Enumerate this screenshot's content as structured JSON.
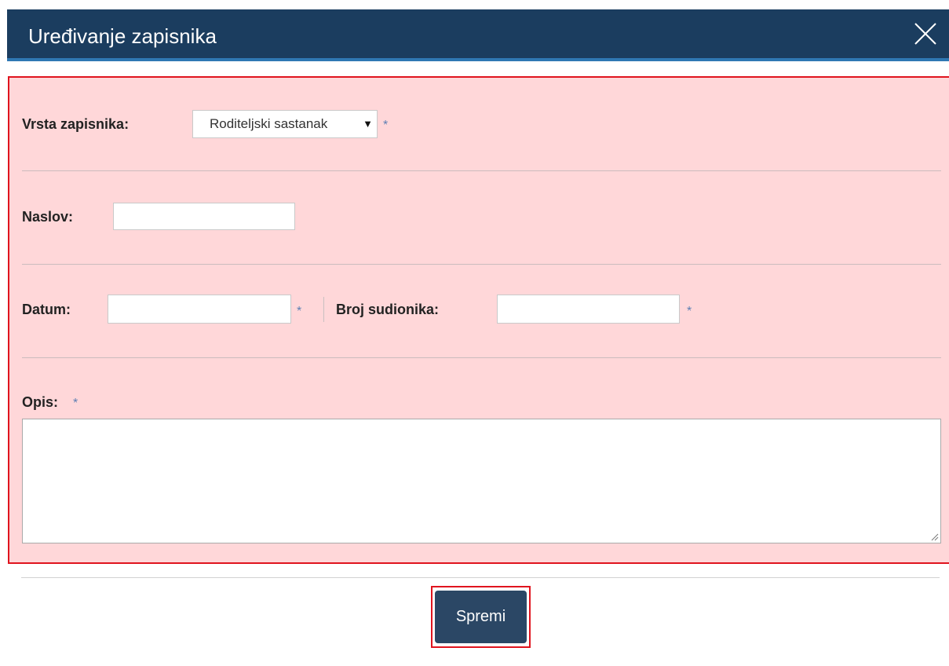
{
  "dialog": {
    "title": "Uređivanje zapisnika",
    "close_icon": "close-icon"
  },
  "form": {
    "vrsta": {
      "label": "Vrsta zapisnika:",
      "selected": "Roditeljski sastanak",
      "arrow": "▼",
      "required_mark": "*"
    },
    "naslov": {
      "label": "Naslov:",
      "value": ""
    },
    "datum": {
      "label": "Datum:",
      "value": "",
      "required_mark": "*"
    },
    "broj_sudionika": {
      "label": "Broj sudionika:",
      "value": "",
      "required_mark": "*"
    },
    "opis": {
      "label": "Opis:",
      "value": "",
      "required_mark": "*"
    }
  },
  "footer": {
    "save_label": "Spremi"
  },
  "colors": {
    "header_bg": "#1b3d5f",
    "header_accent": "#2f78b3",
    "form_bg": "#ffd7d9",
    "highlight_border": "#e0141e",
    "button_bg": "#2b4765",
    "required": "#5d7fb3"
  }
}
